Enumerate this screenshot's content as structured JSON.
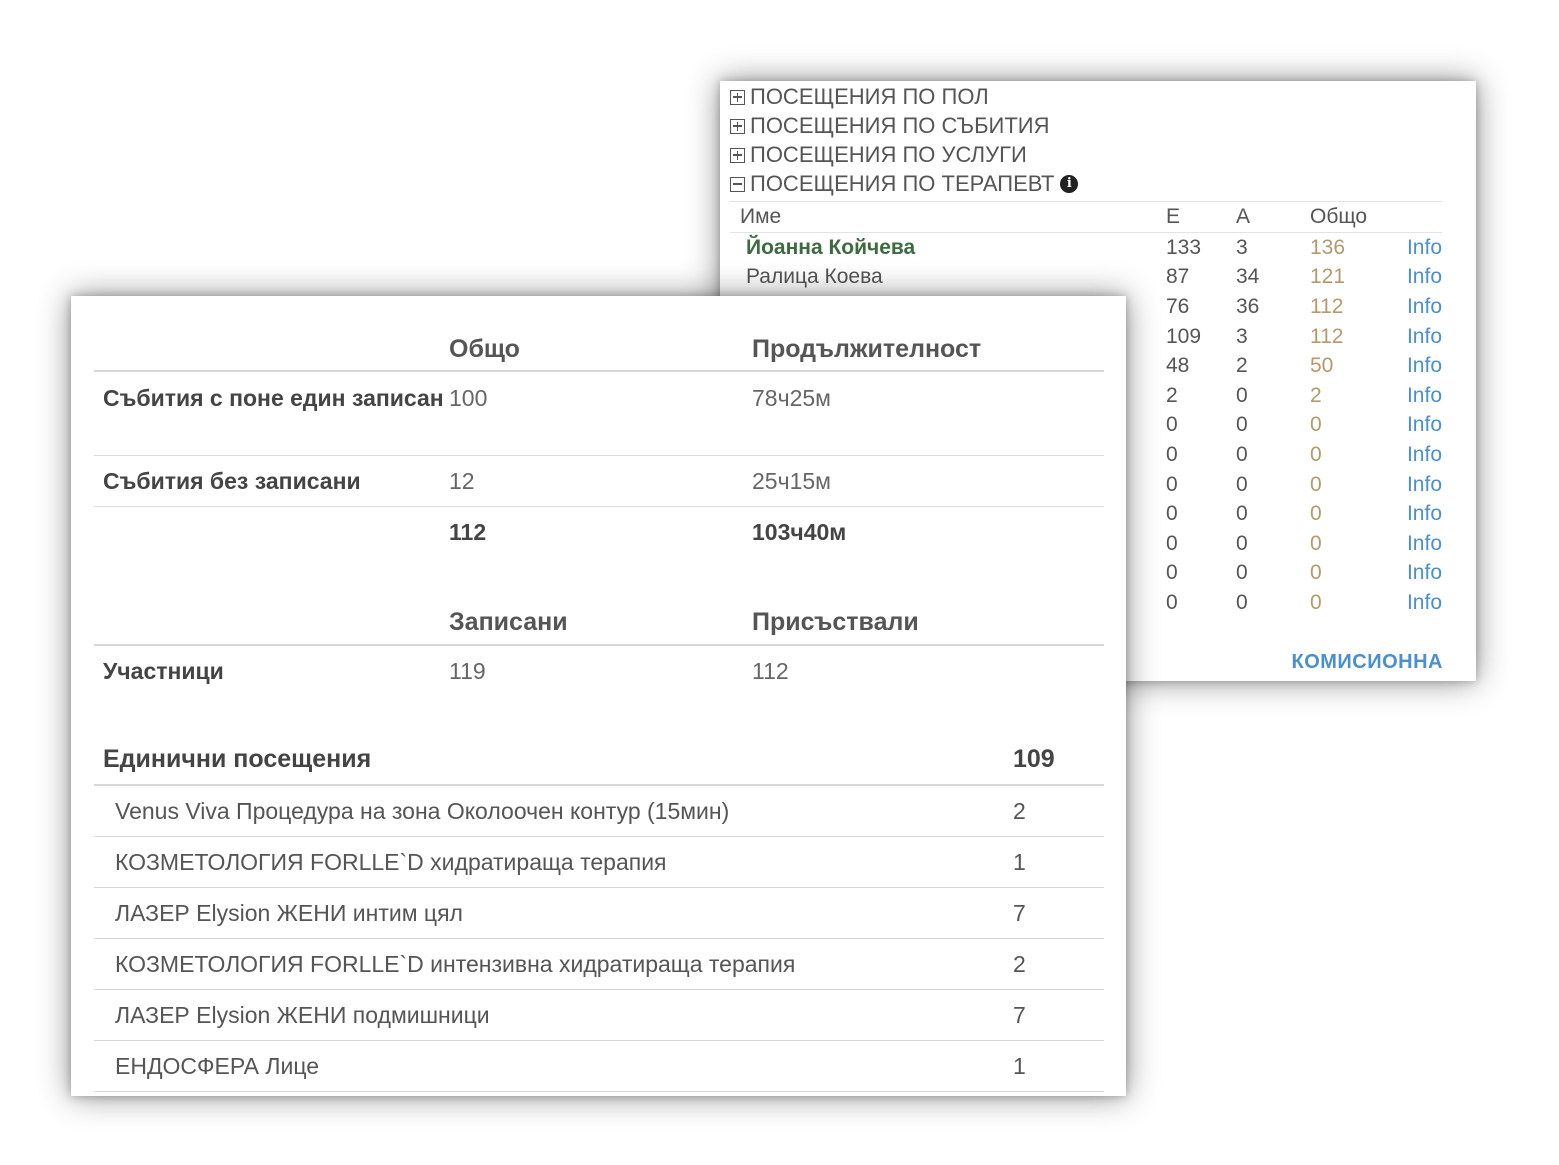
{
  "accordion": [
    {
      "label": "ПОСЕЩЕНИЯ ПО ПОЛ",
      "expanded": false
    },
    {
      "label": "ПОСЕЩЕНИЯ ПО СЪБИТИЯ",
      "expanded": false
    },
    {
      "label": "ПОСЕЩЕНИЯ ПО УСЛУГИ",
      "expanded": false
    },
    {
      "label": "ПОСЕЩЕНИЯ ПО ТЕРАПЕВТ",
      "expanded": true
    }
  ],
  "therapist_table": {
    "headers": [
      "Име",
      "Е",
      "А",
      "Общо"
    ],
    "rows": [
      {
        "name": "Йоанна Койчева",
        "e": "133",
        "a": "3",
        "total": "136",
        "link": "Info"
      },
      {
        "name": "Ралица Коева",
        "e": "87",
        "a": "34",
        "total": "121",
        "link": "Info"
      },
      {
        "name": "",
        "e": "76",
        "a": "36",
        "total": "112",
        "link": "Info"
      },
      {
        "name": "",
        "e": "109",
        "a": "3",
        "total": "112",
        "link": "Info"
      },
      {
        "name": "",
        "e": "48",
        "a": "2",
        "total": "50",
        "link": "Info"
      },
      {
        "name": "",
        "e": "2",
        "a": "0",
        "total": "2",
        "link": "Info"
      },
      {
        "name": "",
        "e": "0",
        "a": "0",
        "total": "0",
        "link": "Info"
      },
      {
        "name": "",
        "e": "0",
        "a": "0",
        "total": "0",
        "link": "Info"
      },
      {
        "name": "",
        "e": "0",
        "a": "0",
        "total": "0",
        "link": "Info"
      },
      {
        "name": "",
        "e": "0",
        "a": "0",
        "total": "0",
        "link": "Info"
      },
      {
        "name": "",
        "e": "0",
        "a": "0",
        "total": "0",
        "link": "Info"
      },
      {
        "name": "",
        "e": "0",
        "a": "0",
        "total": "0",
        "link": "Info"
      },
      {
        "name": "",
        "e": "0",
        "a": "0",
        "total": "0",
        "link": "Info"
      }
    ],
    "commission_label": "КОМИСИОННА"
  },
  "events": {
    "col_total": "Общо",
    "col_duration": "Продължителност",
    "rows": [
      {
        "label": "Събития с поне един записан",
        "total": "100",
        "duration": "78ч25м"
      },
      {
        "label": "Събития без записани",
        "total": "12",
        "duration": "25ч15м"
      }
    ],
    "sum_total": "112",
    "sum_duration": "103ч40м"
  },
  "participants": {
    "col_registered": "Записани",
    "col_attended": "Присъствали",
    "label": "Участници",
    "registered": "119",
    "attended": "112"
  },
  "single_visits": {
    "title": "Единични посещения",
    "total": "109",
    "items": [
      {
        "label": "Venus Viva Процедура на зона Околоочен контур (15мин)",
        "count": "2"
      },
      {
        "label": "КОЗМЕТОЛОГИЯ FORLLE`D хидратираща терапия",
        "count": "1"
      },
      {
        "label": "ЛАЗЕР Elysion ЖЕНИ интим цял",
        "count": "7"
      },
      {
        "label": "КОЗМЕТОЛОГИЯ FORLLE`D интензивна хидратираща терапия",
        "count": "2"
      },
      {
        "label": "ЛАЗЕР Elysion ЖЕНИ подмишници",
        "count": "7"
      },
      {
        "label": "ЕНДОСФЕРА Лице",
        "count": "1"
      }
    ]
  },
  "colors": {
    "link": "#4a8fd0",
    "highlight_name": "#3d6b40",
    "total_col": "#b49a6a"
  }
}
